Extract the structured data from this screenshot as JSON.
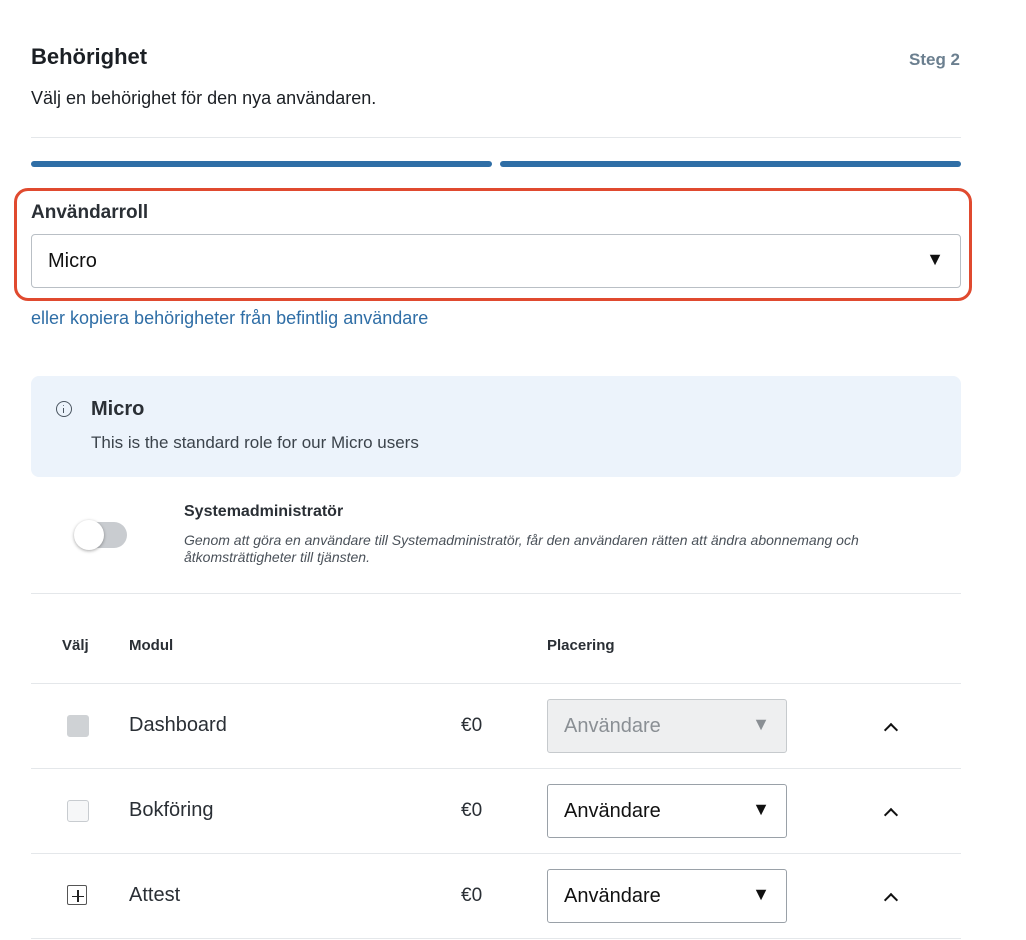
{
  "header": {
    "title": "Behörighet",
    "step": "Steg 2",
    "subtitle": "Välj en behörighet för den nya användaren."
  },
  "progress": {
    "current_step": 2,
    "total_steps": 2
  },
  "role": {
    "label": "Användarroll",
    "selected": "Micro",
    "copy_link": "eller kopiera behörigheter från befintlig användare"
  },
  "info": {
    "icon": "info-icon",
    "title": "Micro",
    "description": "This is the standard role for our Micro users"
  },
  "sysadmin": {
    "title": "Systemadministratör",
    "description": "Genom att göra en användare till Systemadministratör, får den användaren rätten att ändra abonnemang och åtkomsträttigheter till tjänsten.",
    "enabled": false
  },
  "table": {
    "headers": {
      "select": "Välj",
      "module": "Modul",
      "placement": "Placering"
    },
    "rows": [
      {
        "name": "Dashboard",
        "price": "€0",
        "placement": "Användare",
        "checkbox_state": "disabled",
        "placement_disabled": true
      },
      {
        "name": "Bokföring",
        "price": "€0",
        "placement": "Användare",
        "checkbox_state": "unchecked",
        "placement_disabled": false
      },
      {
        "name": "Attest",
        "price": "€0",
        "placement": "Användare",
        "checkbox_state": "expandable",
        "placement_disabled": false
      }
    ]
  },
  "glyphs": {
    "dropdown_arrow": "▼"
  },
  "colors": {
    "accent": "#2f6ea6",
    "highlight_border": "#e04a2f",
    "info_bg": "#ecf3fb",
    "toggle_off": "#c9ccd0"
  }
}
